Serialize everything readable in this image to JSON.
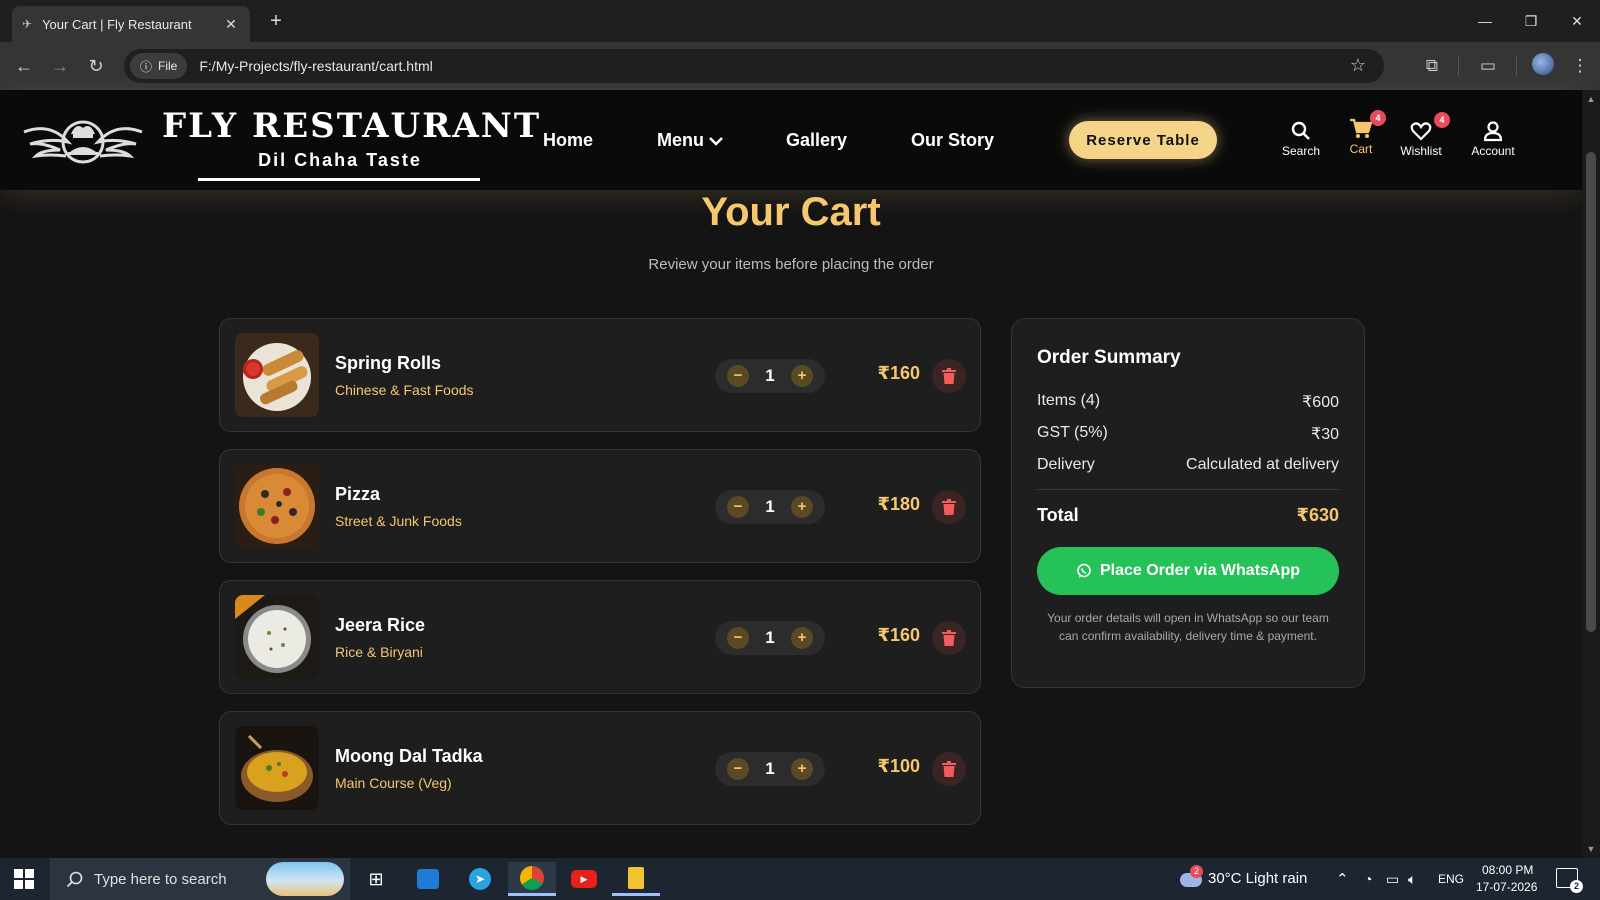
{
  "browser": {
    "tab_title": "Your Cart | Fly Restaurant",
    "new_tab_icon": "plus-icon",
    "file_chip": "File",
    "url": "F:/My-Projects/fly-restaurant/cart.html"
  },
  "header": {
    "brand": "FLY RESTAURANT",
    "tagline": "Dil Chaha Taste",
    "nav": {
      "home": "Home",
      "menu": "Menu",
      "gallery": "Gallery",
      "story": "Our Story"
    },
    "reserve": "Reserve Table",
    "icons": {
      "search": "Search",
      "cart": "Cart",
      "cart_badge": "4",
      "wishlist": "Wishlist",
      "wishlist_badge": "4",
      "account": "Account"
    }
  },
  "page": {
    "title": "Your Cart",
    "subtitle": "Review your items before placing the order"
  },
  "cart": {
    "items": [
      {
        "name": "Spring Rolls",
        "category": "Chinese & Fast Foods",
        "qty": "1",
        "price": "₹160"
      },
      {
        "name": "Pizza",
        "category": "Street & Junk Foods",
        "qty": "1",
        "price": "₹180"
      },
      {
        "name": "Jeera Rice",
        "category": "Rice & Biryani",
        "qty": "1",
        "price": "₹160"
      },
      {
        "name": "Moong Dal Tadka",
        "category": "Main Course (Veg)",
        "qty": "1",
        "price": "₹100"
      }
    ]
  },
  "summary": {
    "title": "Order Summary",
    "items_label": "Items (4)",
    "items_value": "₹600",
    "gst_label": "GST (5%)",
    "gst_value": "₹30",
    "delivery_label": "Delivery",
    "delivery_value": "Calculated at delivery",
    "total_label": "Total",
    "total_value": "₹630",
    "cta": "Place Order via WhatsApp",
    "note": "Your order details will open in WhatsApp so our team can confirm availability, delivery time & payment."
  },
  "taskbar": {
    "search_placeholder": "Type here to search",
    "weather": "30°C  Light rain",
    "weather_badge": "2",
    "lang": "ENG",
    "time": "08:00 PM",
    "date": "17-07-2026",
    "notifications": "2"
  },
  "colors": {
    "accent": "#f5c76e",
    "whatsapp": "#25c25a",
    "badge": "#e74c5b"
  }
}
